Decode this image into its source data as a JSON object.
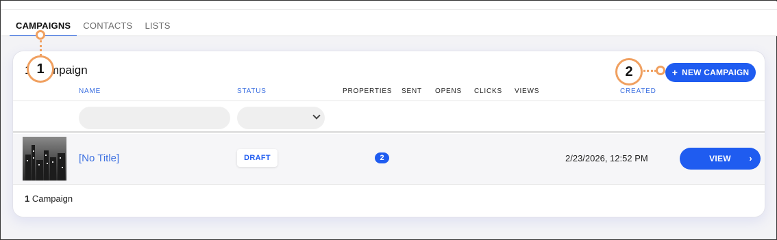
{
  "tabs": [
    {
      "label": "CAMPAIGNS",
      "active": true
    },
    {
      "label": "CONTACTS",
      "active": false
    },
    {
      "label": "LISTS",
      "active": false
    }
  ],
  "card": {
    "title": "1 Campaign",
    "new_button_label": "NEW CAMPAIGN",
    "new_button_icon": "plus-icon"
  },
  "table": {
    "columns": [
      "NAME",
      "STATUS",
      "PROPERTIES",
      "SENT",
      "OPENS",
      "CLICKS",
      "VIEWS",
      "CREATED"
    ],
    "rows": [
      {
        "thumbnail": "city-skyline-image",
        "title": "[No Title]",
        "status": "DRAFT",
        "properties": "2",
        "sent": "",
        "opens": "",
        "clicks": "",
        "views": "",
        "created": "2/23/2026, 12:52 PM",
        "action_label": "VIEW",
        "action_icon": "chevron-right-icon"
      }
    ]
  },
  "footer": {
    "count": "1",
    "label": "Campaign"
  },
  "callouts": [
    {
      "label": "1"
    },
    {
      "label": "2"
    }
  ],
  "colors": {
    "accent": "#1f5cf0",
    "link": "#3b6fe0",
    "callout": "#f0a060"
  }
}
